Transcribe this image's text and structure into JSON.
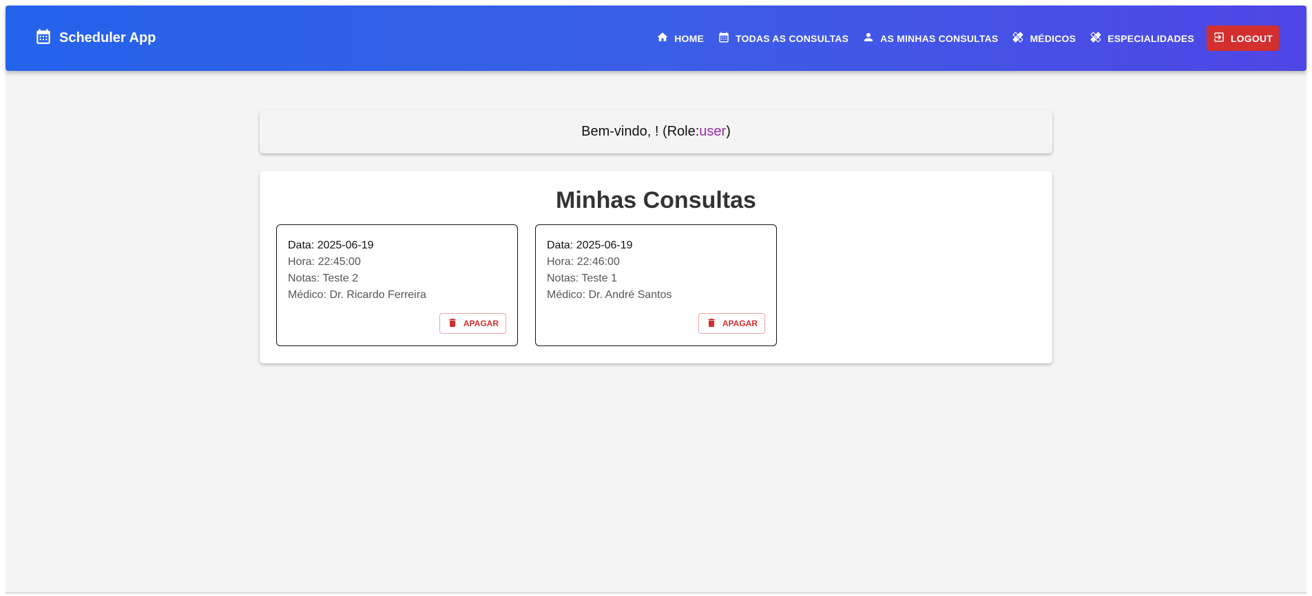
{
  "header": {
    "app_name": "Scheduler App",
    "nav": [
      {
        "label": "HOME",
        "icon": "home-icon"
      },
      {
        "label": "TODAS AS CONSULTAS",
        "icon": "calendar-icon"
      },
      {
        "label": "AS MINHAS CONSULTAS",
        "icon": "person-icon"
      },
      {
        "label": "MÉDICOS",
        "icon": "healing-icon"
      },
      {
        "label": "ESPECIALIDADES",
        "icon": "healing-icon"
      },
      {
        "label": "LOGOUT",
        "icon": "logout-icon"
      }
    ]
  },
  "welcome": {
    "prefix": "Bem-vindo, ! (Role: ",
    "role": "user",
    "suffix": ")"
  },
  "main": {
    "title": "Minhas Consultas",
    "cards": [
      {
        "date": "Data: 2025-06-19",
        "time": "Hora: 22:45:00",
        "notes": "Notas: Teste 2",
        "doctor": "Médico: Dr. Ricardo Ferreira",
        "delete_label": "APAGAR"
      },
      {
        "date": "Data: 2025-06-19",
        "time": "Hora: 22:46:00",
        "notes": "Notas: Teste 1",
        "doctor": "Médico: Dr. André Santos",
        "delete_label": "APAGAR"
      }
    ]
  },
  "colors": {
    "appbar_start": "#2563eb",
    "appbar_end": "#4f46e5",
    "logout": "#d32f2f",
    "role": "#9c27b0",
    "delete": "#d32f2f"
  }
}
